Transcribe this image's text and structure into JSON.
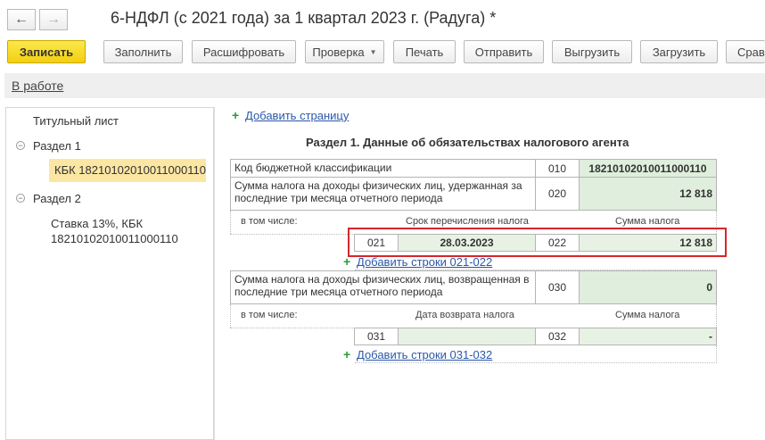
{
  "window": {
    "title": "6-НДФЛ (с 2021 года) за 1 квартал 2023 г. (Радуга) *",
    "back_icon": "←",
    "forward_icon": "→"
  },
  "toolbar": {
    "save": "Записать",
    "fill": "Заполнить",
    "decode": "Расшифровать",
    "check": "Проверка",
    "print": "Печать",
    "send": "Отправить",
    "export": "Выгрузить",
    "import": "Загрузить",
    "more": "Срав"
  },
  "status": {
    "label": "В работе"
  },
  "tree": {
    "title_page": "Титульный лист",
    "section1": "Раздел 1",
    "section1_kbk": "КБК 18210102010011000110",
    "section2": "Раздел 2",
    "section2_item_line1": "Ставка 13%, КБК",
    "section2_item_line2": "18210102010011000110"
  },
  "form": {
    "add_page": "Добавить страницу",
    "section_title": "Раздел 1. Данные об обязательствах налогового агента",
    "kbk_label": "Код бюджетной классификации",
    "kbk_code": "010",
    "kbk_value": "18210102010011000110",
    "withheld_label": "Сумма налога на доходы физических лиц, удержанная за последние три месяца отчетного периода",
    "withheld_code": "020",
    "withheld_value": "12 818",
    "including": "в том числе:",
    "transfer_date_header": "Срок перечисления налога",
    "tax_amount_header": "Сумма налога",
    "row021_code": "021",
    "row021_value": "28.03.2023",
    "row022_code": "022",
    "row022_value": "12 818",
    "add_rows_021": "Добавить строки 021-022",
    "returned_label": "Сумма налога на доходы физических лиц, возвращенная в последние три месяца отчетного периода",
    "returned_code": "030",
    "returned_value": "0",
    "including2": "в том числе:",
    "return_date_header": "Дата возврата налога",
    "tax_amount_header2": "Сумма налога",
    "row031_code": "031",
    "row031_value": "",
    "row032_code": "032",
    "row032_value": "-",
    "add_rows_031": "Добавить строки 031-032"
  },
  "colors": {
    "save_button": "#f2cf10",
    "highlight": "#d6262b",
    "input_fill": "#dfeedd"
  }
}
